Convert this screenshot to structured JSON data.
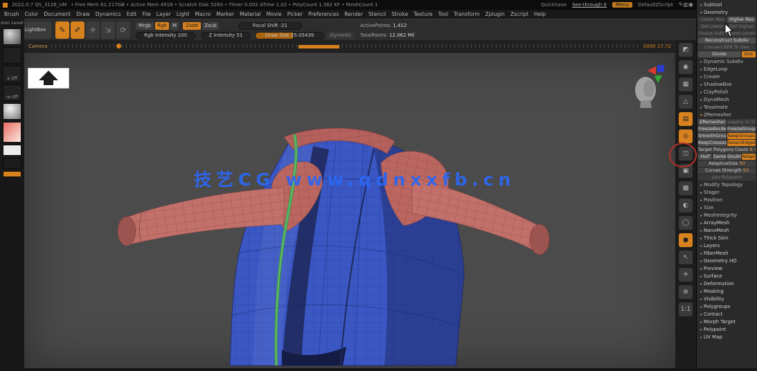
{
  "titlebar": {
    "version": "2022.0.7 QS_3128_UM",
    "stats": "• Free Mem 61.217GB • Active Mem 4918 • Scratch Disk 5283 • Timer 0.002 ATime 1.02 • PolyCount 1.362 KF • MeshCount 1",
    "quicksave": "QuickSave",
    "see_through": "See-through 0",
    "menu": "Menu",
    "default_zscript": "DefaultZScript",
    "icons": [
      {
        "name": "pen-icon",
        "glyph": "✎"
      },
      {
        "name": "meter-icon",
        "glyph": "▥"
      },
      {
        "name": "volume-icon",
        "glyph": "◉"
      }
    ]
  },
  "menubar": {
    "items": [
      "Brush",
      "Color",
      "Document",
      "Draw",
      "Dynamics",
      "Edit",
      "File",
      "Layer",
      "Light",
      "Macro",
      "Marker",
      "Material",
      "Movie",
      "Picker",
      "Preferences",
      "Render",
      "Stencil",
      "Stroke",
      "Texture",
      "Tool",
      "Transform",
      "Zplugin",
      "Zscript",
      "Help"
    ]
  },
  "shelf": {
    "lightbox": "LightBox",
    "tool_buttons": [
      {
        "name": "edit-object-button",
        "glyph": "✎",
        "on": true
      },
      {
        "name": "draw-pointer-button",
        "glyph": "✐",
        "on": true
      },
      {
        "name": "move-button",
        "glyph": "✛",
        "on": false
      },
      {
        "name": "scale-button",
        "glyph": "⇲",
        "on": false
      },
      {
        "name": "rotate-button",
        "glyph": "⟳",
        "on": false
      }
    ],
    "mrgb": "Mrgb",
    "rgb": "Rgb",
    "m": "M",
    "zadd": "Zadd",
    "zsub": "Zsub",
    "focal_shift_label": "Focal Shift",
    "focal_shift_value": "-21",
    "rgb_intensity_label": "Rgb Intensity",
    "rgb_intensity_value": "100",
    "z_intensity_label": "Z Intensity",
    "z_intensity_value": "51",
    "draw_size_label": "Draw Size",
    "draw_size_value": "25.05439",
    "dynamic_label": "Dynamic",
    "active_points_label": "ActivePoints:",
    "active_points_value": "1,412",
    "total_points_label": "TotalPoints:",
    "total_points_value": "12.062 Mil"
  },
  "timeline": {
    "label": "Camera",
    "counter": "0000  17:72"
  },
  "left_tray": {
    "division_label": "sion Level",
    "thumbs": [
      {
        "name": "brush-thumbnail",
        "label": ""
      },
      {
        "name": "stroke-thumbnail",
        "label": ""
      },
      {
        "name": "alpha-thumbnail",
        "label": "a Off"
      },
      {
        "name": "texture-thumbnail",
        "label": "re Off"
      },
      {
        "name": "material-thumbnail",
        "label": ""
      },
      {
        "name": "color-picker",
        "label": ""
      },
      {
        "name": "swatch-white",
        "label": ""
      },
      {
        "name": "swatch-dark",
        "label": ""
      },
      {
        "name": "swatch-orange",
        "label": ""
      }
    ]
  },
  "canvas": {
    "watermark": "技艺CG  www.qdnxxfb.cn"
  },
  "right_shelf": {
    "icons": [
      {
        "name": "spix-icon",
        "glyph": "◩",
        "active": false
      },
      {
        "name": "bpr-icon",
        "glyph": "◉",
        "active": false
      },
      {
        "name": "render-mode-icon",
        "glyph": "▦",
        "active": false
      },
      {
        "name": "persp-icon",
        "glyph": "△",
        "active": false
      },
      {
        "name": "floor-icon",
        "glyph": "▤",
        "active": true
      },
      {
        "name": "local-icon",
        "glyph": "◎",
        "active": true
      },
      {
        "name": "lsym-icon",
        "glyph": "◫",
        "active": false
      },
      {
        "name": "frame-icon",
        "glyph": "▣",
        "active": false
      },
      {
        "name": "polyframe-icon",
        "glyph": "▩",
        "active": false
      },
      {
        "name": "transparency-icon",
        "glyph": "◐",
        "active": false
      },
      {
        "name": "ghost-icon",
        "glyph": "◯",
        "active": false
      },
      {
        "name": "solo-icon",
        "glyph": "●",
        "active": true
      },
      {
        "name": "xpose-icon",
        "glyph": "↖",
        "active": false
      },
      {
        "name": "scroll-icon",
        "glyph": "✛",
        "active": false
      },
      {
        "name": "zoom3d-icon",
        "glyph": "⊕",
        "active": false
      },
      {
        "name": "actual-size-icon",
        "glyph": "1:1",
        "active": false
      }
    ]
  },
  "tool_panel": {
    "rows": [
      {
        "h": "main",
        "label": "Subtool",
        "open": false
      },
      {
        "h": "main",
        "label": "Geometry",
        "open": true
      },
      {
        "cells": [
          {
            "t": "Lower Res",
            "s": "dim"
          },
          {
            "t": "Higher Res"
          }
        ]
      },
      {
        "cells": [
          {
            "t": "Del Lower",
            "s": "dim"
          },
          {
            "t": "Del Higher",
            "s": "dim"
          }
        ]
      },
      {
        "cells": [
          {
            "t": "Freeze SubDivision Levels",
            "s": "dim"
          }
        ]
      },
      {
        "cells": [
          {
            "t": "Reconstruct Subdiv"
          }
        ]
      },
      {
        "cells": [
          {
            "t": "Convert BPR To Geo",
            "s": "dim"
          }
        ]
      },
      {
        "cells": [
          {
            "t": "Divide",
            "f": 3
          },
          {
            "t": "Smt",
            "s": "orange",
            "f": 1
          }
        ]
      },
      {
        "h": "sub",
        "label": "Dynamic Subdiv",
        "open": false
      },
      {
        "h": "sub",
        "label": "EdgeLoop",
        "open": false
      },
      {
        "h": "sub",
        "label": "Create",
        "open": false
      },
      {
        "h": "sub",
        "label": "ShadowBox",
        "open": false
      },
      {
        "h": "sub",
        "label": "ClayPolish",
        "open": false
      },
      {
        "h": "sub",
        "label": "DynaMesh",
        "open": false
      },
      {
        "h": "sub",
        "label": "Tessimate",
        "open": false
      },
      {
        "h": "sub",
        "label": "ZRemesher",
        "open": true,
        "accent": true
      },
      {
        "cells": [
          {
            "t": "ZRemesher"
          },
          {
            "t": "Legacy (2.5)",
            "s": "dim"
          }
        ]
      },
      {
        "cells": [
          {
            "t": "FreezeBorder"
          },
          {
            "t": "FreezeGroups"
          }
        ]
      },
      {
        "cells": [
          {
            "t": "SmoothGroups"
          },
          {
            "t": "KeepGroups",
            "s": "orange"
          }
        ]
      },
      {
        "cells": [
          {
            "t": "KeepCreases"
          },
          {
            "t": "DetectEdges",
            "s": "orange"
          }
        ]
      },
      {
        "slider": {
          "label": "Target Polygons Count",
          "value": "6.43"
        }
      },
      {
        "cells": [
          {
            "t": "Half"
          },
          {
            "t": "Same"
          },
          {
            "t": "Double"
          },
          {
            "t": "Adapt",
            "s": "orange"
          }
        ]
      },
      {
        "slider": {
          "label": "AdaptiveSize",
          "value": "50"
        }
      },
      {
        "slider": {
          "label": "Curves Strength",
          "value": "50"
        }
      },
      {
        "cells": [
          {
            "t": "Use Polypaint",
            "s": "dim"
          }
        ]
      },
      {
        "h": "sub",
        "label": "Modify Topology",
        "open": false
      },
      {
        "h": "sub",
        "label": "Stager",
        "open": false
      },
      {
        "h": "sub",
        "label": "Position",
        "open": false
      },
      {
        "h": "sub",
        "label": "Size",
        "open": false
      },
      {
        "h": "sub",
        "label": "MeshIntegrity",
        "open": false
      },
      {
        "h": "main",
        "label": "ArrayMesh",
        "open": false
      },
      {
        "h": "main",
        "label": "NanoMesh",
        "open": false
      },
      {
        "h": "main",
        "label": "Thick Skin",
        "open": false
      },
      {
        "h": "main",
        "label": "Layers",
        "open": false
      },
      {
        "h": "main",
        "label": "FiberMesh",
        "open": false
      },
      {
        "h": "main",
        "label": "Geometry HD",
        "open": false
      },
      {
        "h": "main",
        "label": "Preview",
        "open": false
      },
      {
        "h": "main",
        "label": "Surface",
        "open": false
      },
      {
        "h": "main",
        "label": "Deformation",
        "open": false
      },
      {
        "h": "main",
        "label": "Masking",
        "open": false
      },
      {
        "h": "main",
        "label": "Visibility",
        "open": false
      },
      {
        "h": "main",
        "label": "Polygroups",
        "open": false
      },
      {
        "h": "main",
        "label": "Contact",
        "open": false
      },
      {
        "h": "main",
        "label": "Morph Target",
        "open": false
      },
      {
        "h": "main",
        "label": "Polypaint",
        "open": false
      },
      {
        "h": "main",
        "label": "UV Map",
        "open": false
      }
    ]
  },
  "colors": {
    "accent_orange": "#d8821f",
    "watermark_blue": "#2c67f2",
    "vest_blue": "#3a57c4",
    "sleeve_red": "#c2706a",
    "trim_green": "#3e9e4b",
    "annotation_red": "#b23127"
  }
}
